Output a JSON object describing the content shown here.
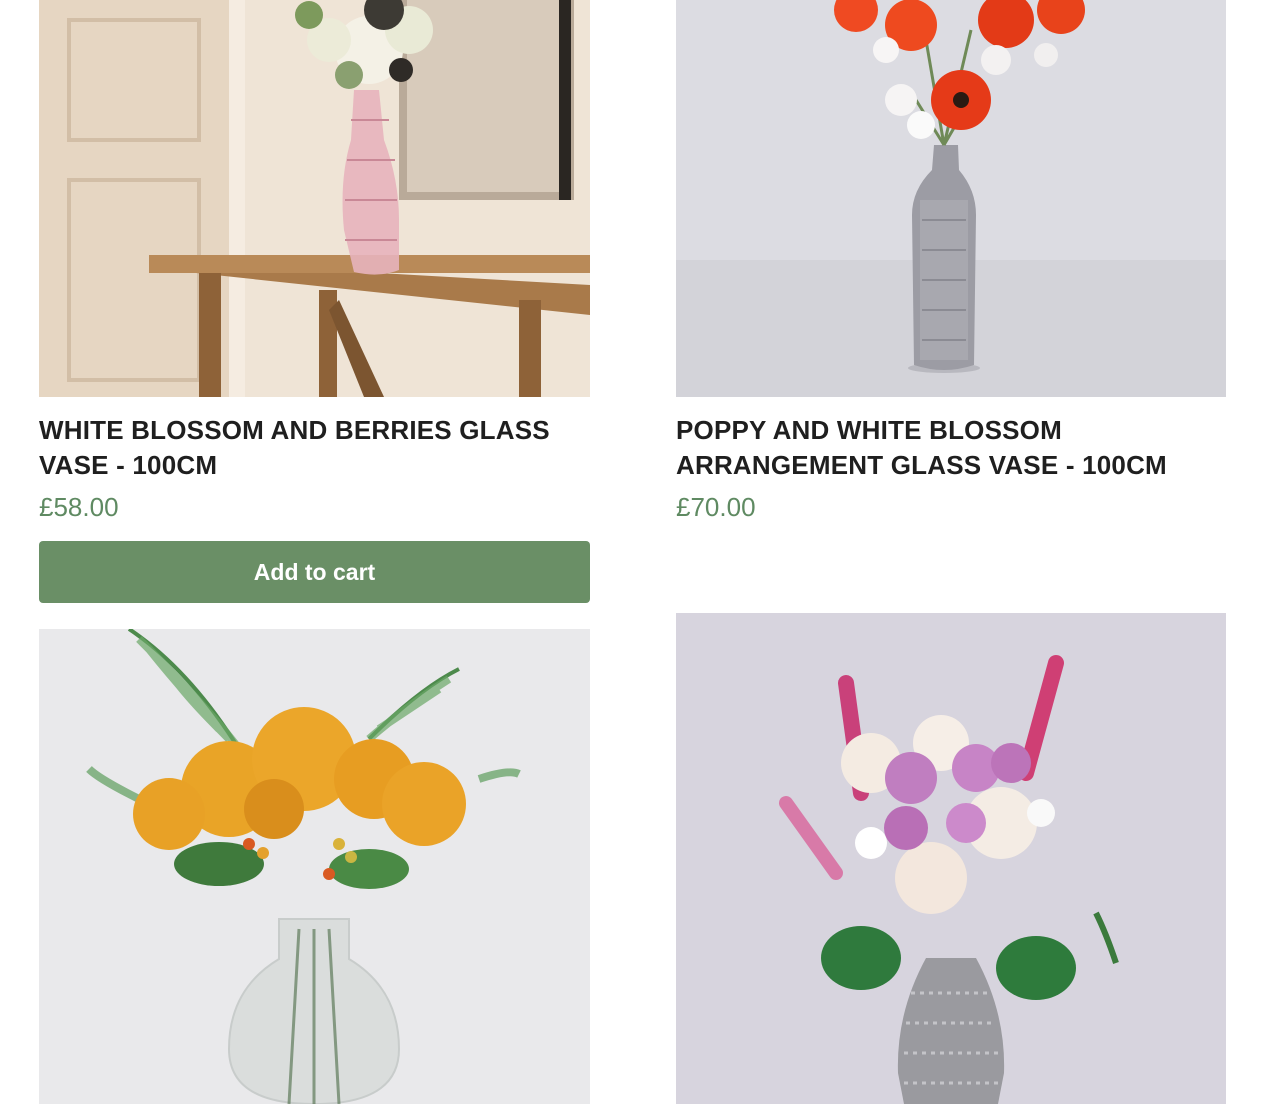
{
  "products": [
    {
      "image_alt": "white blossom and berries in pink glass vase on wooden console table",
      "title": "WHITE BLOSSOM AND BERRIES GLASS VASE - 100CM",
      "price": "£58.00",
      "cta": "Add to cart"
    },
    {
      "image_alt": "red poppies and white blossom in tall silver textured vase",
      "title": "POPPY AND WHITE BLOSSOM ARRANGEMENT GLASS VASE - 100CM",
      "price": "£70.00"
    },
    {
      "image_alt": "orange chrysanthemums with palm leaves and berries in round glass vase"
    },
    {
      "image_alt": "pink and white carnations, dahlias and monstera leaves in silver beaded vase"
    }
  ],
  "colors": {
    "accent": "#6a8f66",
    "price": "#5f8a62",
    "title": "#1f1f1f"
  }
}
